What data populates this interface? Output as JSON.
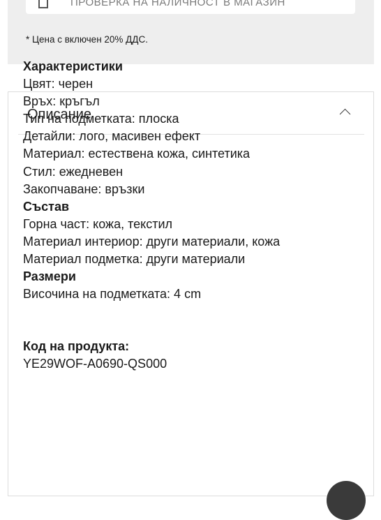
{
  "availability_check": {
    "label": "ПРОВЕРКА НА НАЛИЧНОСТ В МАГАЗИН",
    "icon": "store-icon"
  },
  "vat_note": "* Цена с включен 20% ДДС.",
  "description": {
    "title": "Описание",
    "toggle_icon": "chevron-up-icon",
    "sections": [
      {
        "heading": "Характеристики",
        "lines": [
          "Цвят: черен",
          "Връх: кръгъл",
          "Тип на подметката: плоска",
          "Детайли: лого, масивен ефект",
          "Материал: естествена кожа, синтетика",
          "Стил: ежедневен",
          "Закопчаване: връзки"
        ]
      },
      {
        "heading": "Състав",
        "lines": [
          "Горна част: кожа, текстил",
          "Материал интериор: други материали, кожа",
          "Материал подметка: други материали"
        ]
      },
      {
        "heading": "Размери",
        "lines": [
          "Височина на подметката: 4 cm"
        ]
      }
    ],
    "product_code_label": "Код на продукта:",
    "product_code_value": "YE29WOF-A0690-QS000"
  },
  "floating_button": {
    "icon": "chat-icon"
  }
}
